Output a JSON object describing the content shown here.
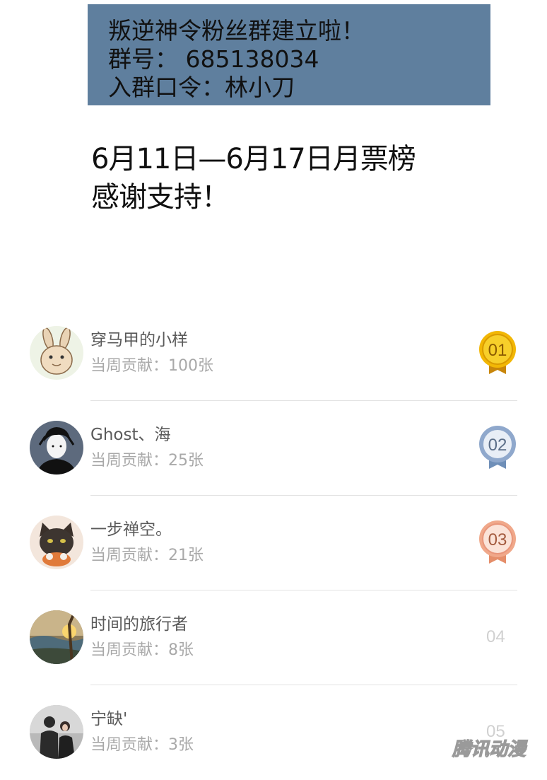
{
  "banner": {
    "line1": "叛逆神令粉丝群建立啦！",
    "line2": "群号： 685138034",
    "line3": "入群口令：林小刀",
    "background": "#5f7f9e"
  },
  "heading": {
    "line1": "6月11日—6月17日月票榜",
    "line2": "感谢支持！"
  },
  "ranking": [
    {
      "rank": "01",
      "name": "穿马甲的小样",
      "contribution": "当周贡献：100张",
      "medal": "gold",
      "avatar_icon": "rabbit-avatar-icon"
    },
    {
      "rank": "02",
      "name": "Ghost、海",
      "contribution": "当周贡献：25张",
      "medal": "silver",
      "avatar_icon": "ink-portrait-avatar-icon"
    },
    {
      "rank": "03",
      "name": "一步禅空。",
      "contribution": "当周贡献：21张",
      "medal": "bronze",
      "avatar_icon": "cat-avatar-icon"
    },
    {
      "rank": "04",
      "name": "时间的旅行者",
      "contribution": "当周贡献：8张",
      "medal": null,
      "avatar_icon": "landscape-avatar-icon"
    },
    {
      "rank": "05",
      "name": "宁缺'",
      "contribution": "当周贡献：3张",
      "medal": null,
      "avatar_icon": "couple-photo-avatar-icon"
    }
  ],
  "colors": {
    "gold": "#f2b705",
    "silver": "#8fa8cc",
    "bronze": "#f0a88a",
    "name_text": "#5a5a5a",
    "secondary_text": "#a9a9a9",
    "divider": "#e2e2e2"
  },
  "watermark": {
    "text": "腾讯动漫"
  }
}
